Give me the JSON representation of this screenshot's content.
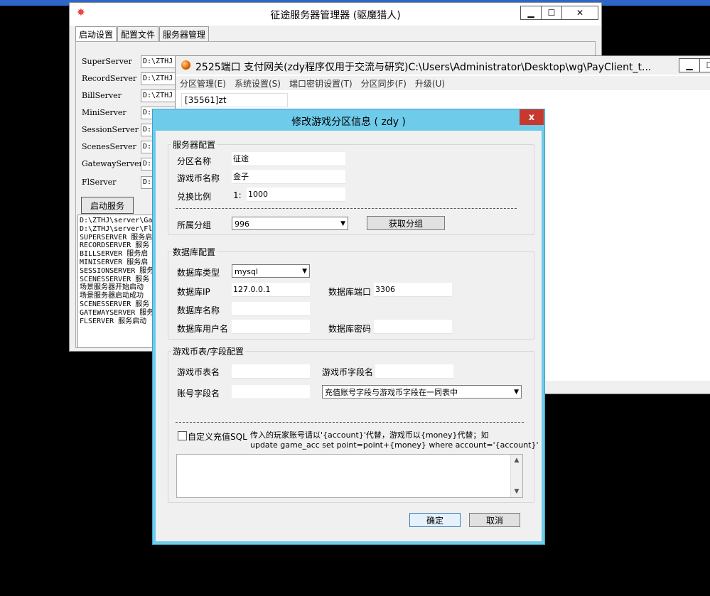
{
  "win1": {
    "title": "征途服务器管理器 (驱魔猎人)",
    "tabs": [
      "启动设置",
      "配置文件",
      "服务器管理"
    ],
    "servers": [
      {
        "label": "SuperServer",
        "value": "D:\\ZTHJ"
      },
      {
        "label": "RecordServer",
        "value": "D:\\ZTHJ"
      },
      {
        "label": "BillServer",
        "value": "D:\\ZTHJ"
      },
      {
        "label": "MiniServer",
        "value": "D:\\ZTHJ"
      },
      {
        "label": "SessionServer",
        "value": "D:"
      },
      {
        "label": "ScenesServer",
        "value": "D:"
      },
      {
        "label": "GatewayServer",
        "value": "D:"
      },
      {
        "label": "FlServer",
        "value": "D:"
      }
    ],
    "start_button": "启动服务",
    "log": "D:\\ZTHJ\\server\\Ga\nD:\\ZTHJ\\server\\Fl\nSUPERSERVER 服务启\nRECORDSERVER 服务\nBILLSERVER 服务启\nMINISERVER 服务启\nSESSIONSERVER 服务\nSCENESSERVER 服务\n场景服务器开始启动\n场景服务器启动成功\nSCENESSERVER 服务\nGATEWAYSERVER 服务\nFLSERVER 服务启动",
    "caption": {
      "min": "▁",
      "max": "☐",
      "close": "✕"
    }
  },
  "win2": {
    "title": "2525端口 支付网关(zdy程序仅用于交流与研究)C:\\Users\\Administrator\\Desktop\\wg\\PayClient_t...",
    "menus": [
      "分区管理(E)",
      "系统设置(S)",
      "端口密钥设置(T)",
      "分区同步(F)",
      "升级(U)"
    ],
    "list": [
      "[35561]zt"
    ],
    "caption": {
      "min": "▁",
      "max": "☐"
    }
  },
  "dialog": {
    "title": "修改游戏分区信息 ( zdy )",
    "close": "x",
    "server_group": {
      "title": "服务器配置",
      "zone_name_label": "分区名称",
      "zone_name": "征途",
      "currency_label": "游戏币名称",
      "currency": "金子",
      "ratio_label": "兑换比例",
      "ratio_prefix": "1:",
      "ratio": "1000",
      "group_label": "所属分组",
      "group_value": "996",
      "fetch_button": "获取分组"
    },
    "db_group": {
      "title": "数据库配置",
      "type_label": "数据库类型",
      "type_value": "mysql",
      "ip_label": "数据库IP",
      "ip": "127.0.0.1",
      "port_label": "数据库端口",
      "port": "3306",
      "name_label": "数据库名称",
      "name": "",
      "user_label": "数据库用户名",
      "user": "",
      "pass_label": "数据库密码",
      "pass": ""
    },
    "table_group": {
      "title": "游戏币表/字段配置",
      "table_label": "游戏币表名",
      "table": "",
      "field_label": "游戏币字段名",
      "field": "",
      "account_label": "账号字段名",
      "account": "",
      "mode_value": "充值账号字段与游戏币字段在一同表中",
      "custom_sql_label": "自定义充值SQL",
      "hint1": "传入的玩家账号请以'{account}'代替，游戏币以{money}代替；如",
      "hint2": "update game_acc set point=point+{money} where account='{account}'"
    },
    "ok": "确定",
    "cancel": "取消"
  }
}
